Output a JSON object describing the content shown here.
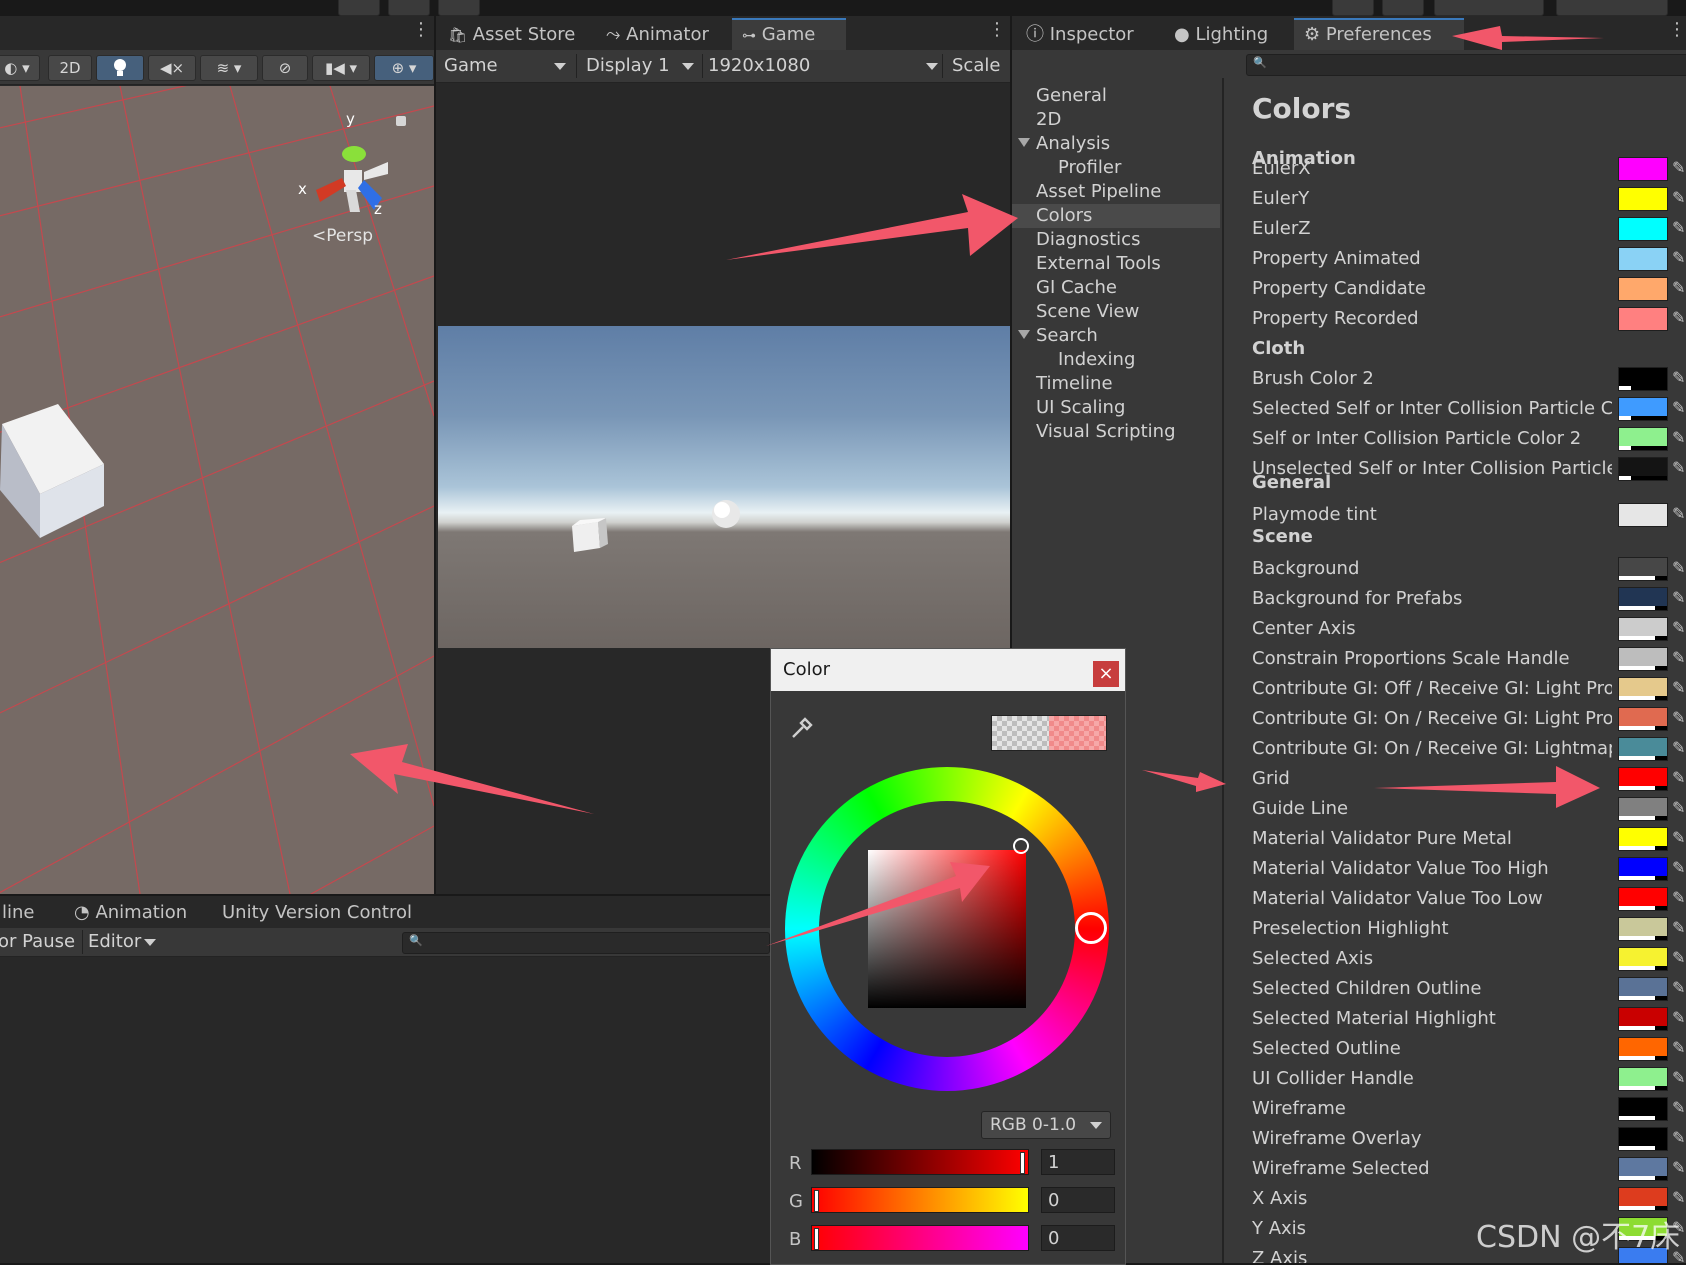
{
  "scene": {
    "toolbar": {
      "mode_2d": "2D"
    },
    "gizmo": {
      "axis_y": "y",
      "axis_x": "x",
      "axis_z": "z",
      "projection": "Persp"
    }
  },
  "game": {
    "tabs": [
      {
        "label": "Asset Store"
      },
      {
        "label": "Animator"
      },
      {
        "label": "Game"
      }
    ],
    "toolbar": {
      "view": "Game",
      "display": "Display 1",
      "resolution": "1920x1080",
      "scale": "Scale"
    }
  },
  "inspector": {
    "tabs": [
      {
        "label": "Inspector"
      },
      {
        "label": "Lighting"
      },
      {
        "label": "Preferences"
      }
    ],
    "nav": [
      {
        "label": "General"
      },
      {
        "label": "2D"
      },
      {
        "label": "Analysis"
      },
      {
        "label": "Profiler"
      },
      {
        "label": "Asset Pipeline"
      },
      {
        "label": "Colors"
      },
      {
        "label": "Diagnostics"
      },
      {
        "label": "External Tools"
      },
      {
        "label": "GI Cache"
      },
      {
        "label": "Scene View"
      },
      {
        "label": "Search"
      },
      {
        "label": "Indexing"
      },
      {
        "label": "Timeline"
      },
      {
        "label": "UI Scaling"
      },
      {
        "label": "Visual Scripting"
      }
    ],
    "colors_title": "Colors",
    "sections": {
      "animation": "Animation",
      "cloth": "Cloth",
      "general": "General",
      "scene": "Scene"
    },
    "rows": [
      {
        "label": "EulerX",
        "color": "#ff00ff"
      },
      {
        "label": "EulerY",
        "color": "#ffff00"
      },
      {
        "label": "EulerZ",
        "color": "#00ffff"
      },
      {
        "label": "Property Animated",
        "color": "#8ad2f5"
      },
      {
        "label": "Property Candidate",
        "color": "#ffa86b"
      },
      {
        "label": "Property Recorded",
        "color": "#ff8080"
      },
      {
        "label": "Brush Color 2",
        "color": "#000000"
      },
      {
        "label": "Selected Self or Inter Collision Particle Color",
        "color": "#3f9bff"
      },
      {
        "label": "Self or Inter Collision Particle Color 2",
        "color": "#8ef08e"
      },
      {
        "label": "Unselected Self or Inter Collision Particle Color",
        "color": "#141414"
      },
      {
        "label": "Playmode tint",
        "color": "#e6e6e6"
      },
      {
        "label": "Background",
        "color": "#474747"
      },
      {
        "label": "Background for Prefabs",
        "color": "#213553"
      },
      {
        "label": "Center Axis",
        "color": "#cccccc"
      },
      {
        "label": "Constrain Proportions Scale Handle",
        "color": "#bdbdbd"
      },
      {
        "label": "Contribute GI: Off / Receive GI: Light Probes",
        "color": "#e5c98c"
      },
      {
        "label": "Contribute GI: On / Receive GI: Light Probes",
        "color": "#e06a50"
      },
      {
        "label": "Contribute GI: On / Receive GI: Lightmaps",
        "color": "#4a8b99"
      },
      {
        "label": "Grid",
        "color": "#ff0000"
      },
      {
        "label": "Guide Line",
        "color": "#808080"
      },
      {
        "label": "Material Validator Pure Metal",
        "color": "#ffff00"
      },
      {
        "label": "Material Validator Value Too High",
        "color": "#0000ff"
      },
      {
        "label": "Material Validator Value Too Low",
        "color": "#ff0000"
      },
      {
        "label": "Preselection Highlight",
        "color": "#c9c89a"
      },
      {
        "label": "Selected Axis",
        "color": "#f6f230"
      },
      {
        "label": "Selected Children Outline",
        "color": "#5a7296"
      },
      {
        "label": "Selected Material Highlight",
        "color": "#c90000"
      },
      {
        "label": "Selected Outline",
        "color": "#ff6600"
      },
      {
        "label": "UI Collider Handle",
        "color": "#8ef08e"
      },
      {
        "label": "Wireframe",
        "color": "#000000"
      },
      {
        "label": "Wireframe Overlay",
        "color": "#000000"
      },
      {
        "label": "Wireframe Selected",
        "color": "#5e78a0"
      },
      {
        "label": "X Axis",
        "color": "#dd3c1e"
      },
      {
        "label": "Y Axis",
        "color": "#8ddc32"
      },
      {
        "label": "Z Axis",
        "color": "#3a7cf0"
      }
    ]
  },
  "console": {
    "tabs": [
      {
        "label": "line"
      },
      {
        "label": "Animation"
      },
      {
        "label": "Unity Version Control"
      }
    ],
    "toolbar": {
      "pause": "or Pause",
      "editor": "Editor"
    }
  },
  "color_dialog": {
    "title": "Color",
    "close": "×",
    "mode": "RGB 0-1.0",
    "channels": [
      {
        "label": "R",
        "value": "1"
      },
      {
        "label": "G",
        "value": "0"
      },
      {
        "label": "B",
        "value": "0"
      }
    ]
  },
  "watermark": "CSDN @不7床"
}
